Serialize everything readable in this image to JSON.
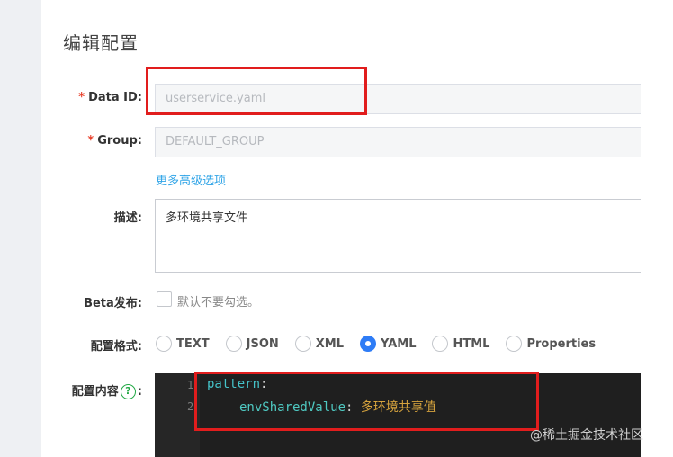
{
  "page": {
    "title": "编辑配置"
  },
  "form": {
    "data_id": {
      "label": "Data ID:",
      "required": true,
      "value": "userservice.yaml"
    },
    "group": {
      "label": "Group:",
      "required": true,
      "value": "DEFAULT_GROUP"
    },
    "advanced_link": "更多高级选项",
    "description": {
      "label": "描述:",
      "value": "多环境共享文件"
    },
    "beta": {
      "label": "Beta发布:",
      "checkbox_text": "默认不要勾选。"
    },
    "format": {
      "label": "配置格式:",
      "options": [
        "TEXT",
        "JSON",
        "XML",
        "YAML",
        "HTML",
        "Properties"
      ],
      "selected": "YAML"
    },
    "content": {
      "label": "配置内容",
      "help_glyph": "?",
      "colon": ":",
      "lines": [
        {
          "number": "1",
          "key": "pattern",
          "sep": ":",
          "value": ""
        },
        {
          "number": "2",
          "key": "envSharedValue",
          "sep": ":",
          "value": "多环境共享值"
        }
      ]
    }
  },
  "colors": {
    "accent": "#2e7cf6",
    "link": "#2fa4e7",
    "annotation": "#e11d1d",
    "help": "#22a845"
  },
  "watermark": "@稀土掘金技术社区"
}
